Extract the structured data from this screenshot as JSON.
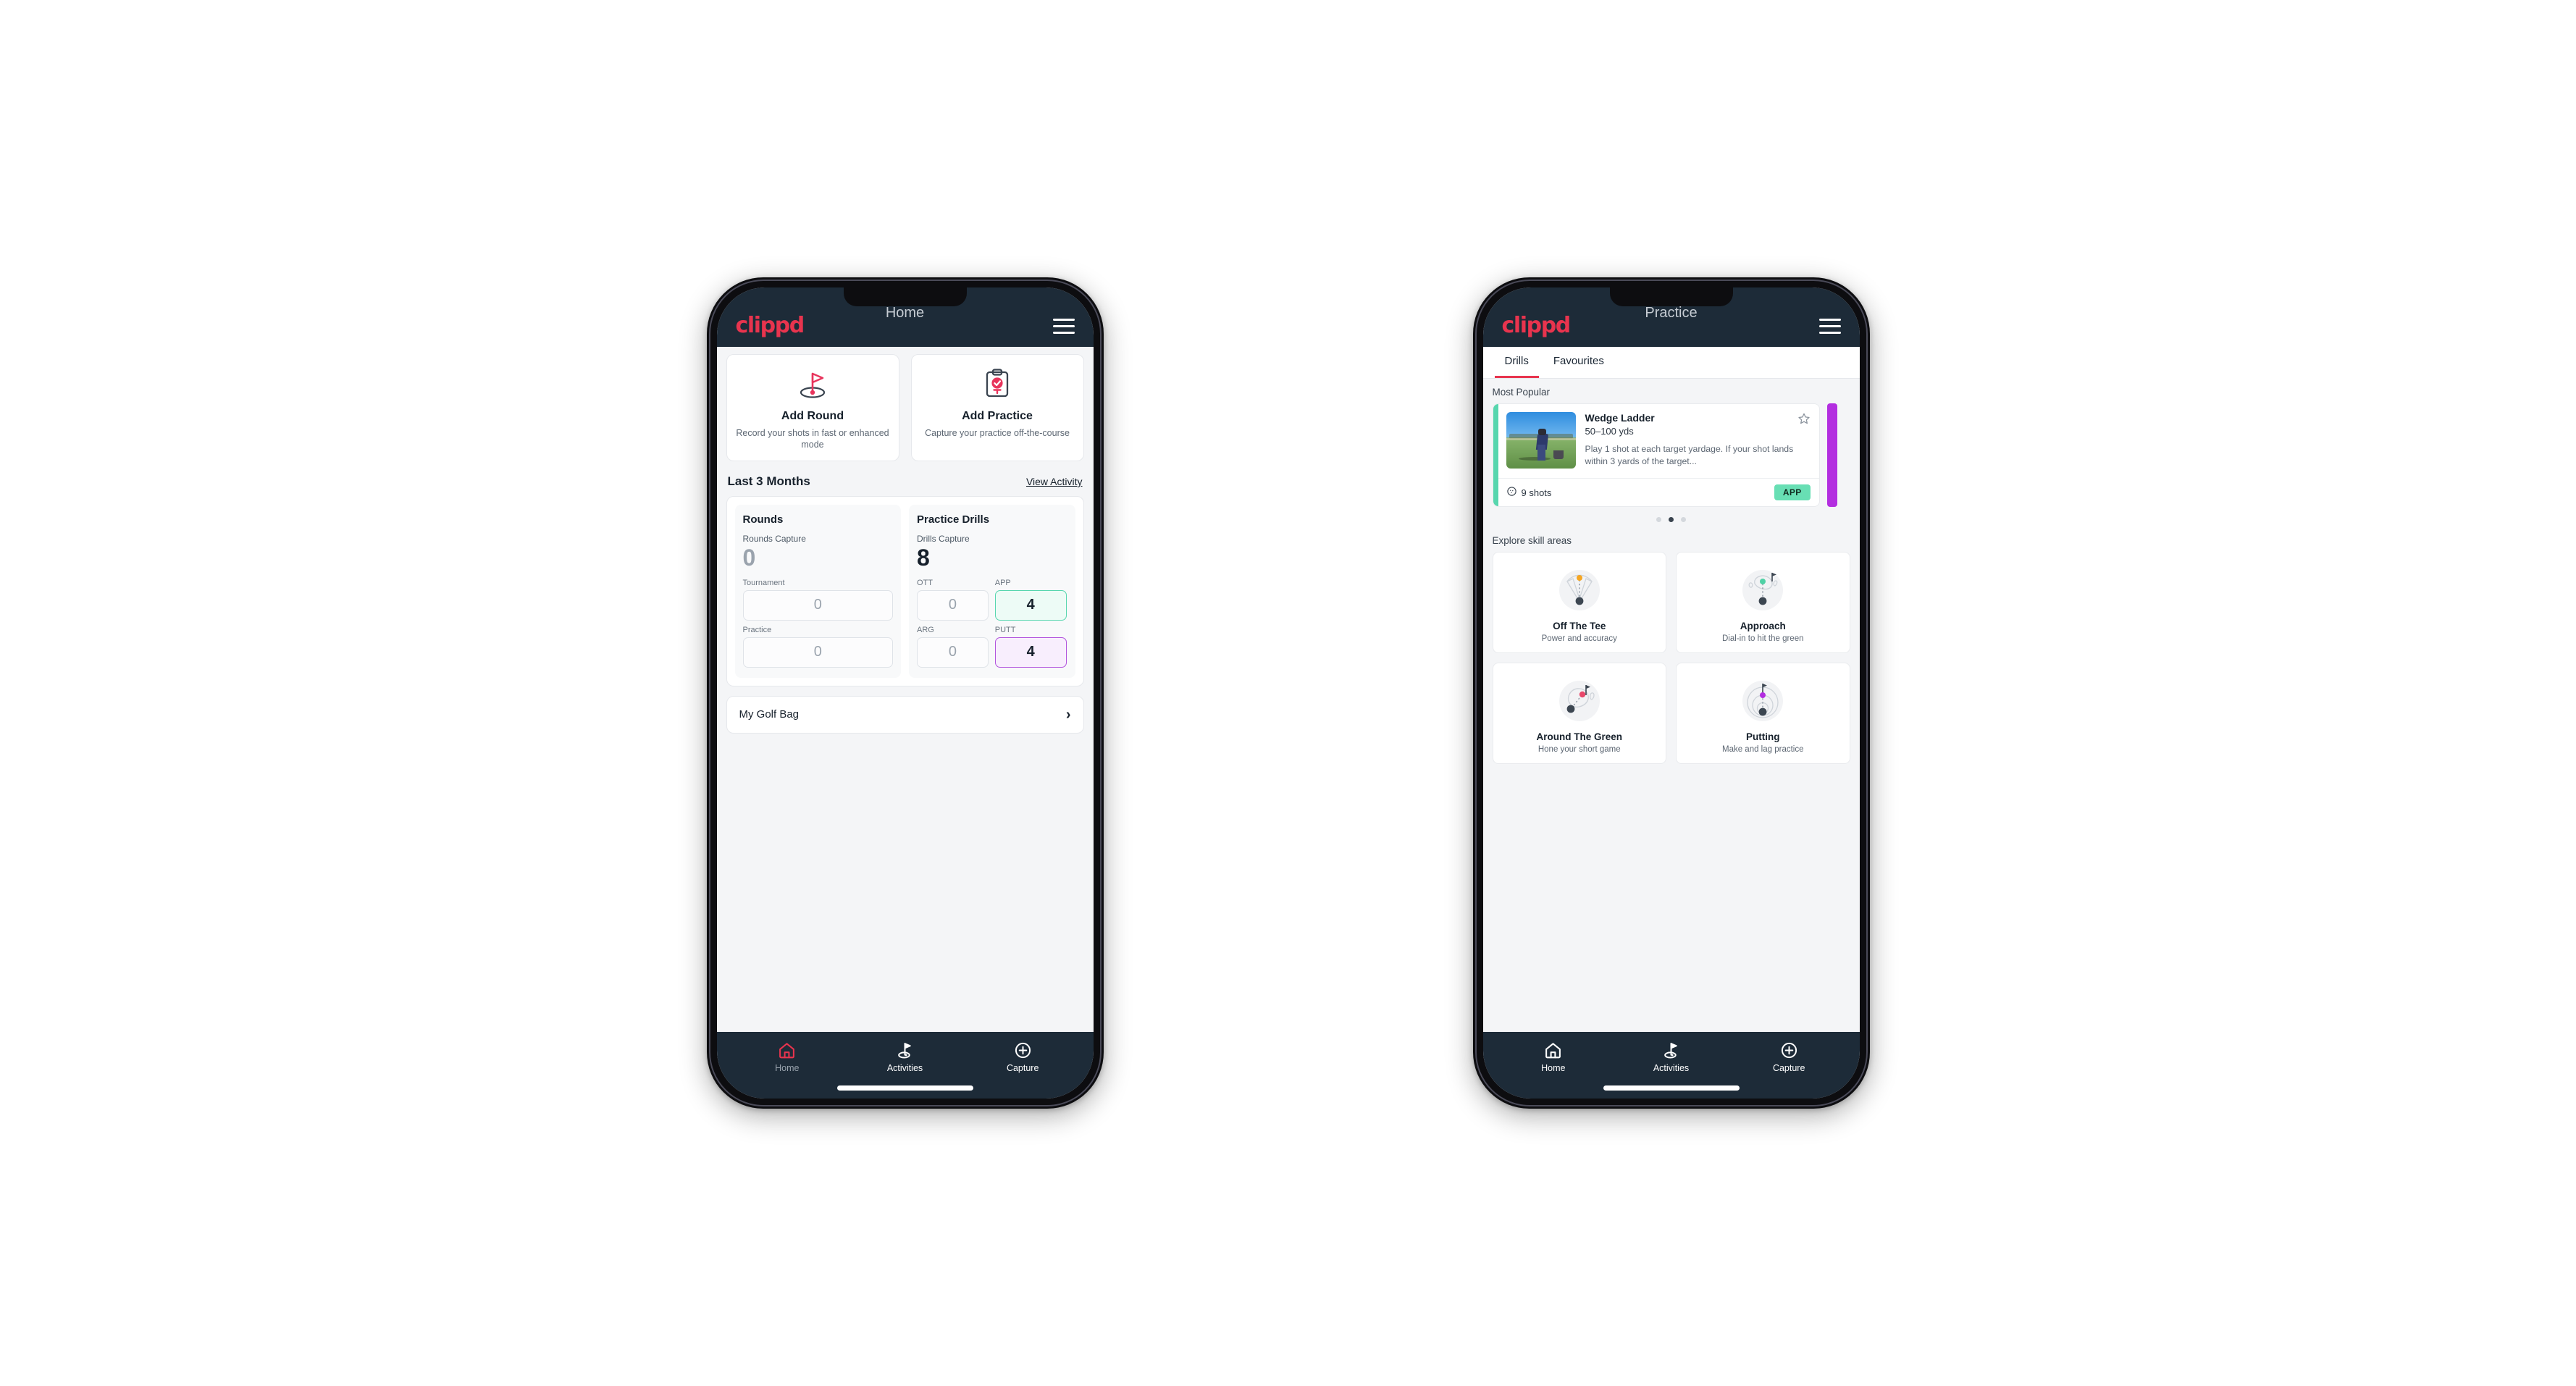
{
  "phones": [
    {
      "header": {
        "logo": "clippd",
        "title": "Home",
        "menu_icon": "hamburger-menu-icon"
      },
      "home": {
        "actions": [
          {
            "icon": "golf-flag-hole-icon",
            "title": "Add Round",
            "subtitle": "Record your shots in fast or enhanced mode"
          },
          {
            "icon": "clipboard-check-icon",
            "title": "Add Practice",
            "subtitle": "Capture your practice off-the-course"
          }
        ],
        "section": {
          "title": "Last 3 Months",
          "link": "View Activity"
        },
        "stats": [
          {
            "heading": "Rounds",
            "capture_label": "Rounds Capture",
            "capture_value": "0",
            "capture_muted": true,
            "boxes": [
              {
                "label": "Tournament",
                "value": "0",
                "style": "plain",
                "width": "full"
              },
              {
                "label": "Practice",
                "value": "0",
                "style": "plain",
                "width": "full"
              }
            ]
          },
          {
            "heading": "Practice Drills",
            "capture_label": "Drills Capture",
            "capture_value": "8",
            "capture_muted": false,
            "boxes": [
              {
                "label": "OTT",
                "value": "0",
                "style": "plain",
                "width": "half"
              },
              {
                "label": "APP",
                "value": "4",
                "style": "green",
                "width": "half"
              },
              {
                "label": "ARG",
                "value": "0",
                "style": "plain",
                "width": "half"
              },
              {
                "label": "PUTT",
                "value": "4",
                "style": "purple",
                "width": "half"
              }
            ]
          }
        ],
        "bag": {
          "label": "My Golf Bag",
          "chevron": "chevron-right-icon"
        }
      },
      "nav": [
        {
          "icon": "home-icon",
          "label": "Home",
          "active": true,
          "label_dim": true
        },
        {
          "icon": "golf-flag-icon",
          "label": "Activities",
          "active": false,
          "label_dim": false
        },
        {
          "icon": "plus-circle-icon",
          "label": "Capture",
          "active": false,
          "label_dim": false
        }
      ]
    },
    {
      "header": {
        "logo": "clippd",
        "title": "Practice",
        "menu_icon": "hamburger-menu-icon"
      },
      "practice": {
        "tabs": [
          {
            "label": "Drills",
            "active": true
          },
          {
            "label": "Favourites",
            "active": false
          }
        ],
        "most_popular_label": "Most Popular",
        "drill": {
          "accent_color": "#57d6ae",
          "peek_color": "#b32ee0",
          "title": "Wedge Ladder",
          "yardage": "50–100 yds",
          "description": "Play 1 shot at each target yardage. If your shot lands within 3 yards of the target...",
          "shots": "9 shots",
          "shots_icon": "golf-ball-icon",
          "badge": "APP",
          "badge_color": "#68dfb4",
          "favourite_icon": "star-outline-icon",
          "thumbnail": "golfer-on-fairway-photo"
        },
        "carousel_dots": {
          "count": 3,
          "active_index": 1
        },
        "skill_label": "Explore skill areas",
        "skills": [
          {
            "icon": "tee-shot-fan-icon",
            "marker_color": "#f5a623",
            "title": "Off The Tee",
            "subtitle": "Power and accuracy"
          },
          {
            "icon": "green-approach-icon",
            "marker_color": "#4fd1a5",
            "title": "Approach",
            "subtitle": "Dial-in to hit the green"
          },
          {
            "icon": "chip-around-green-icon",
            "marker_color": "#e8486b",
            "title": "Around The Green",
            "subtitle": "Hone your short game"
          },
          {
            "icon": "putting-rings-icon",
            "marker_color": "#b32ee0",
            "title": "Putting",
            "subtitle": "Make and lag practice"
          }
        ]
      },
      "nav": [
        {
          "icon": "home-icon",
          "label": "Home",
          "active": false,
          "label_dim": false
        },
        {
          "icon": "golf-flag-icon",
          "label": "Activities",
          "active": false,
          "label_dim": false
        },
        {
          "icon": "plus-circle-icon",
          "label": "Capture",
          "active": false,
          "label_dim": false
        }
      ]
    }
  ],
  "colors": {
    "brand_pink": "#e8344e",
    "header_navy": "#1d2b38",
    "green_accent": "#57d6ae",
    "purple_accent": "#b254dd"
  }
}
